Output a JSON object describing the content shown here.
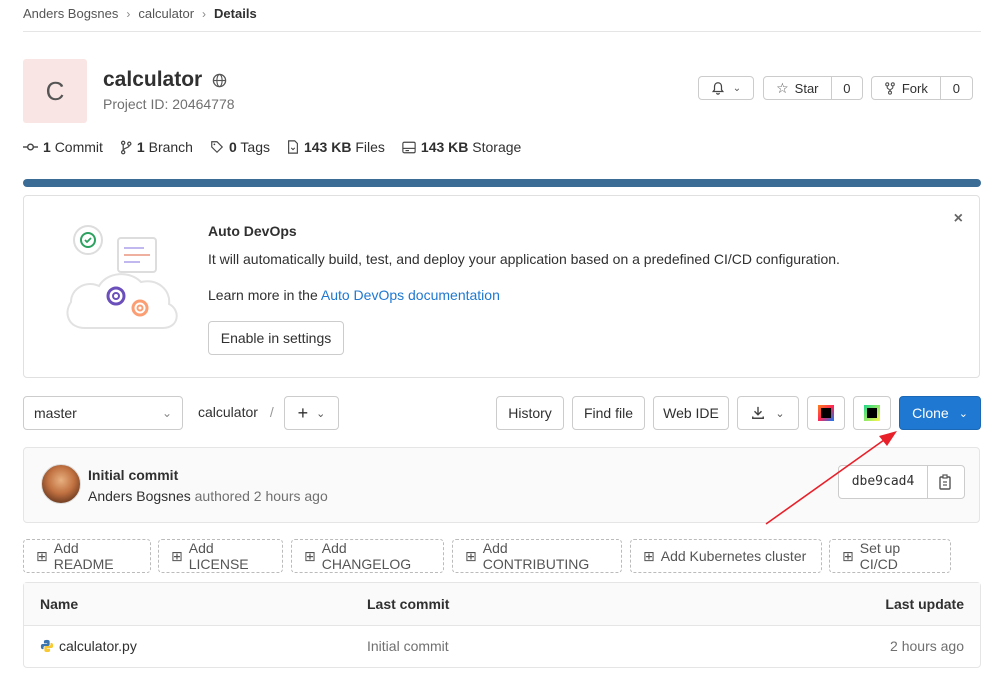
{
  "breadcrumb": {
    "owner": "Anders Bogsnes",
    "project": "calculator",
    "current": "Details"
  },
  "project": {
    "avatar_letter": "C",
    "name": "calculator",
    "id_label": "Project ID: 20464778"
  },
  "header_actions": {
    "star_label": "Star",
    "star_count": "0",
    "fork_label": "Fork",
    "fork_count": "0"
  },
  "stats": [
    {
      "value": "1",
      "label": "Commit"
    },
    {
      "value": "1",
      "label": "Branch"
    },
    {
      "value": "0",
      "label": "Tags"
    },
    {
      "value": "143 KB",
      "label": "Files"
    },
    {
      "value": "143 KB",
      "label": "Storage"
    }
  ],
  "devops": {
    "title": "Auto DevOps",
    "description": "It will automatically build, test, and deploy your application based on a predefined CI/CD configuration.",
    "learn_prefix": "Learn more in the",
    "learn_link": "Auto DevOps documentation",
    "enable_button": "Enable in settings"
  },
  "repo": {
    "branch": "master",
    "path_root": "calculator",
    "path_sep": "/",
    "add_symbol": "+",
    "history": "History",
    "find_file": "Find file",
    "web_ide": "Web IDE",
    "clone": "Clone"
  },
  "commit": {
    "message": "Initial commit",
    "author": "Anders Bogsnes",
    "authored": "authored 2 hours ago",
    "sha": "dbe9cad4"
  },
  "quick_actions": [
    "Add README",
    "Add LICENSE",
    "Add CHANGELOG",
    "Add CONTRIBUTING",
    "Add Kubernetes cluster",
    "Set up CI/CD"
  ],
  "files_table": {
    "headers": {
      "name": "Name",
      "last_commit": "Last commit",
      "last_update": "Last update"
    },
    "rows": [
      {
        "name": "calculator.py",
        "last_commit": "Initial commit",
        "last_update": "2 hours ago"
      }
    ]
  },
  "colors": {
    "accent": "#1f78d1",
    "progress": "#3a6c96",
    "annotation_arrow": "#e8202a"
  }
}
